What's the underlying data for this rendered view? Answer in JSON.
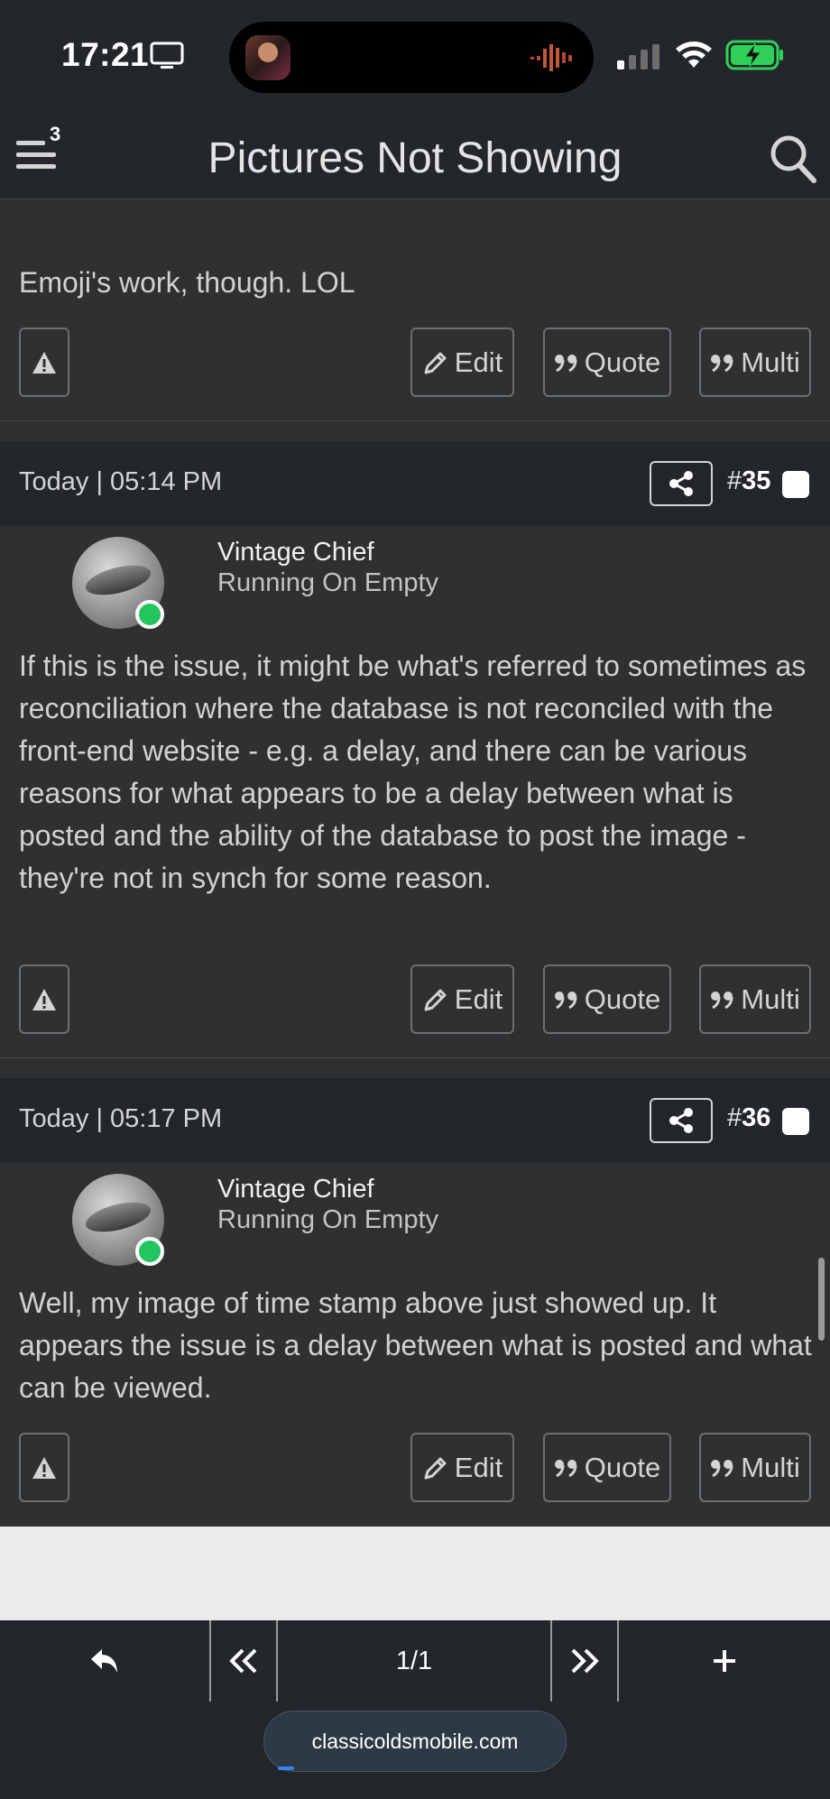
{
  "status_bar": {
    "time": "17:21"
  },
  "header": {
    "title": "Pictures Not Showing",
    "menu_badge": "3",
    "icons": [
      "hamburger-menu-icon",
      "search-icon"
    ]
  },
  "buttons": {
    "edit": "Edit",
    "quote": "Quote",
    "multi": "Multi"
  },
  "previous_post": {
    "text": "Emoji's work, though. LOL"
  },
  "posts": [
    {
      "date": "Today | 05:14 PM",
      "number_prefix": "#",
      "number": "35",
      "author": "Vintage Chief",
      "author_title": "Running On Empty",
      "online": true,
      "text": "If this is the issue, it might be what's referred to sometimes as reconciliation where the database is not reconciled with the front-end website - e.g. a delay, and there can be various reasons for what appears to be a delay between what is posted and the ability of the database to post the image - they're not in synch for some reason."
    },
    {
      "date": "Today | 05:17 PM",
      "number_prefix": "#",
      "number": "36",
      "author": "Vintage Chief",
      "author_title": "Running On Empty",
      "online": true,
      "text": "Well, my image of time stamp above just showed up. It appears the issue is a delay between what is posted and what can be viewed."
    }
  ],
  "bottom_nav": {
    "page_indicator": "1/1",
    "url": "classicoldsmobile.com"
  },
  "colors": {
    "background": "#2f3031",
    "header": "#23272b",
    "online": "#22c55e"
  }
}
